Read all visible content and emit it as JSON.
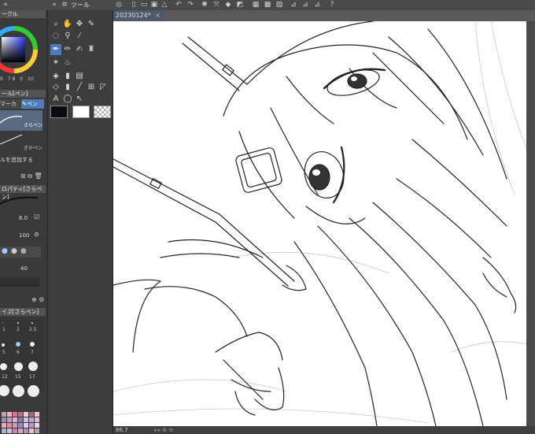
{
  "document": {
    "tab_label": "20230124*",
    "close_glyph": "×"
  },
  "left_panel": {
    "color_panel_title": "ークル",
    "color_readout": {
      "a": "0",
      "b": "7",
      "c": "8",
      "d": "0",
      "e": "10"
    },
    "sub_tool_title": "ール[ペン]",
    "sub_tool_tab_marker": "マーカ",
    "sub_tool_tab_pen": "ペン",
    "brush_items": [
      {
        "label": "さらペン"
      },
      {
        "label": "ぎかペン"
      }
    ],
    "add_sub_tool_label": "ルを追加する",
    "property_title": "ロパティ[さらペン]",
    "brush_size_value": "6.0",
    "opacity_value": "100",
    "stabilization_value": "40",
    "brush_size_panel_title": "イズ[さらペン]",
    "brush_sizes": [
      "1",
      "2",
      "2.5",
      "5",
      "6",
      "7",
      "12",
      "15",
      "17"
    ]
  },
  "tool_panel": {
    "title": "ツール"
  },
  "status": {
    "zoom": "86.7"
  },
  "colors": {
    "main_color": "#0a0a14",
    "sub_color": "#ffffff",
    "accent": "#4f7bbd",
    "palette": [
      "#c8a0a8",
      "#e6b4c0",
      "#d07890",
      "#b07088",
      "#e8d0d8",
      "#a86878",
      "#f0c8d0",
      "#9090c0",
      "#c09cc8",
      "#e0b0c8",
      "#8878a8",
      "#d0c0e0",
      "#b8a8d0",
      "#e8b8d8",
      "#f0a8b8",
      "#d890a0",
      "#c0a0c0",
      "#9888b8",
      "#e8c8e8",
      "#b098c8",
      "#f0d8e0",
      "#a8b0d0",
      "#d8b8d0",
      "#c088a8",
      "#e0a0b8",
      "#9898c8",
      "#f0c0c8",
      "#b8a0b8"
    ]
  }
}
